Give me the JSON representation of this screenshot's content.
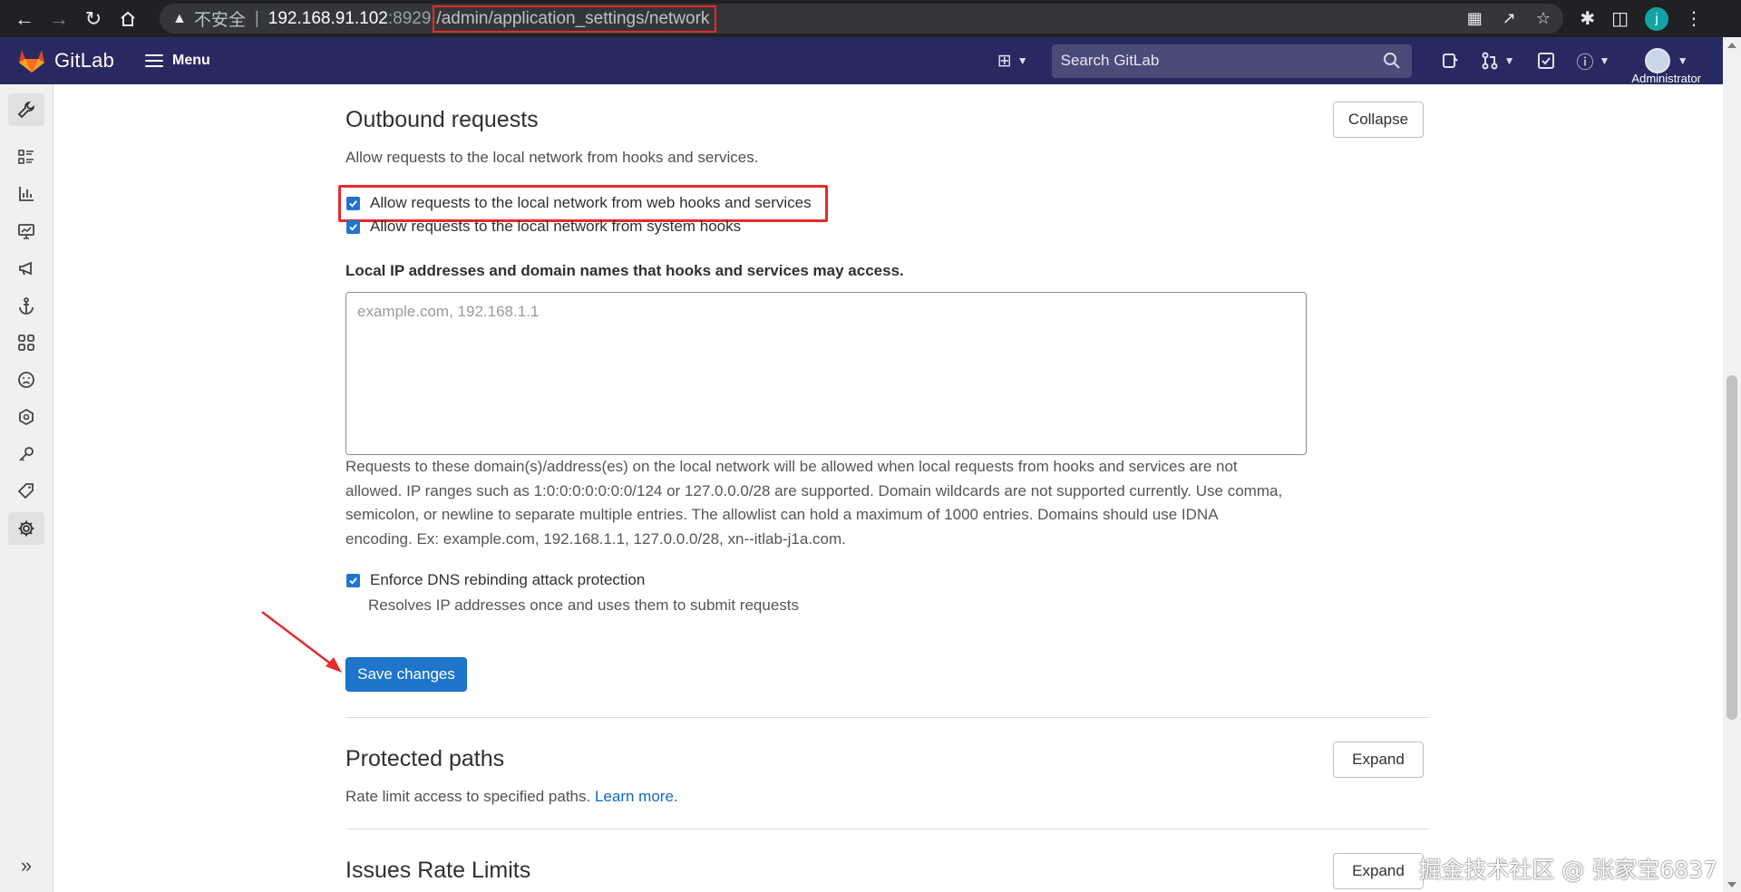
{
  "browser": {
    "insecure_label": "不安全",
    "url_host": "192.168.91.102",
    "url_port": ":8929",
    "url_path": "/admin/application_settings/network",
    "profile_initial": "j"
  },
  "header": {
    "brand": "GitLab",
    "menu_label": "Menu",
    "search_placeholder": "Search GitLab",
    "user_name": "Administrator"
  },
  "outbound": {
    "title": "Outbound requests",
    "description": "Allow requests to the local network from hooks and services.",
    "collapse_label": "Collapse",
    "checkbox_webhooks": "Allow requests to the local network from web hooks and services",
    "checkbox_system_hooks": "Allow requests to the local network from system hooks",
    "allowlist_label": "Local IP addresses and domain names that hooks and services may access.",
    "allowlist_placeholder": "example.com, 192.168.1.1",
    "allowlist_help_1": "Requests to these domain(s)/address(es) on the local network will be allowed when local requests from hooks and services are not",
    "allowlist_help_2": "allowed. IP ranges such as 1:0:0:0:0:0:0:0/124 or 127.0.0.0/28 are supported. Domain wildcards are not supported currently. Use comma,",
    "allowlist_help_3": "semicolon, or newline to separate multiple entries. The allowlist can hold a maximum of 1000 entries. Domains should use IDNA",
    "allowlist_help_4": "encoding. Ex: example.com, 192.168.1.1, 127.0.0.0/28, xn--itlab-j1a.com.",
    "dns_label": "Enforce DNS rebinding attack protection",
    "dns_help": "Resolves IP addresses once and uses them to submit requests",
    "save_label": "Save changes"
  },
  "protected_paths": {
    "title": "Protected paths",
    "description": "Rate limit access to specified paths.",
    "learn_more": "Learn more.",
    "expand_label": "Expand"
  },
  "issues_rate_limits": {
    "title": "Issues Rate Limits",
    "expand_label": "Expand"
  },
  "watermark": "掘金技术社区 @ 张家宝6837",
  "colors": {
    "header_bg": "#292961",
    "primary": "#1f75cb",
    "highlight": "#e52b2b"
  }
}
